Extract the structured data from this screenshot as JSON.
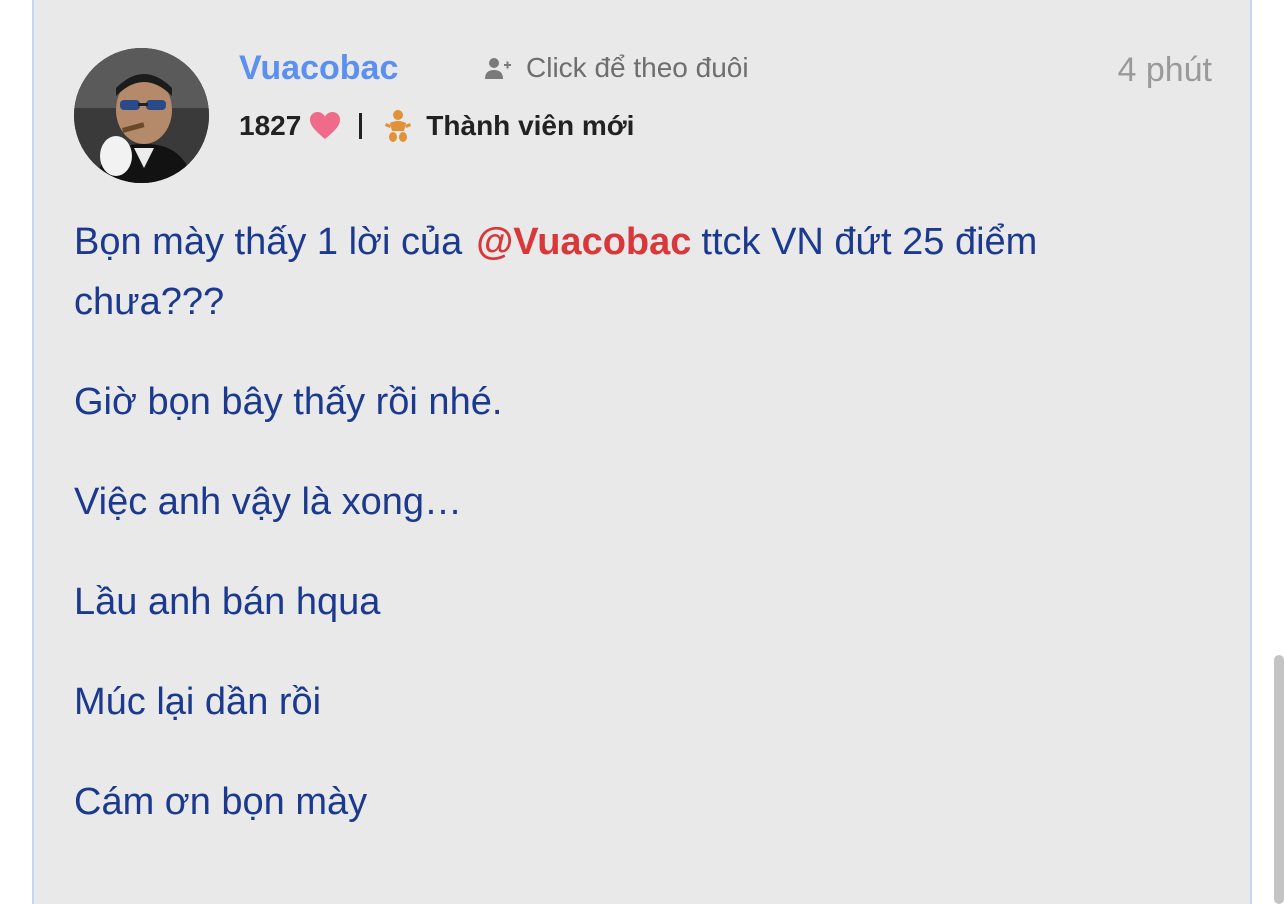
{
  "post": {
    "author": {
      "username": "Vuacobac",
      "score": "1827",
      "rank": "Thành viên mới",
      "avatar_icon": "user-avatar-photo"
    },
    "follow_label": "Click để theo đuôi",
    "time": "4 phút",
    "content": {
      "paragraph1_before": "Bọn mày thấy 1 lời của",
      "mention": "@Vuacobac",
      "paragraph1_after": "ttck VN đứt 25 điểm chưa???",
      "paragraph2": "Giờ bọn bây thấy rồi nhé.",
      "paragraph3": "Việc anh vậy là xong…",
      "paragraph4": "Lầu anh bán hqua",
      "paragraph5": "Múc lại dần rồi",
      "paragraph6": "Cám ơn bọn mày"
    }
  },
  "colors": {
    "username": "#5b8ff0",
    "mention": "#d8383a",
    "content_text": "#1b3a8f",
    "heart": "#f06b8a",
    "rank_icon": "#e0913a",
    "card_background": "#e9e9e9"
  }
}
